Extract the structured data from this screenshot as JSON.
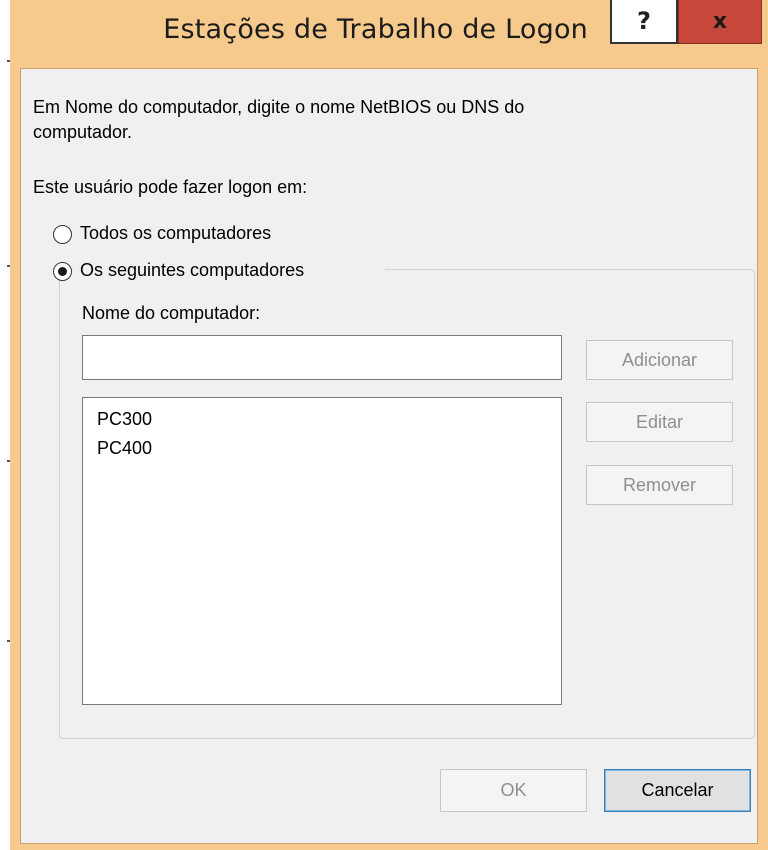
{
  "window": {
    "title": "Estações de Trabalho de Logon",
    "help_label": "?",
    "close_label": "x"
  },
  "instructions": {
    "line1": "Em Nome do computador, digite o nome NetBIOS ou DNS do",
    "line2": "computador."
  },
  "logon_label": "Este usuário pode fazer logon em:",
  "options": {
    "all": {
      "label": "Todos os computadores",
      "selected": false
    },
    "following": {
      "label": "Os seguintes computadores",
      "selected": true
    }
  },
  "computer_name": {
    "label": "Nome do computador:",
    "value": ""
  },
  "computers": [
    "PC300",
    "PC400"
  ],
  "buttons": {
    "add": "Adicionar",
    "edit": "Editar",
    "remove": "Remover",
    "ok": "OK",
    "cancel": "Cancelar"
  },
  "colors": {
    "title_bar": "#f6c98c",
    "close_button": "#c7483a",
    "dialog_background": "#f0f0f0"
  }
}
